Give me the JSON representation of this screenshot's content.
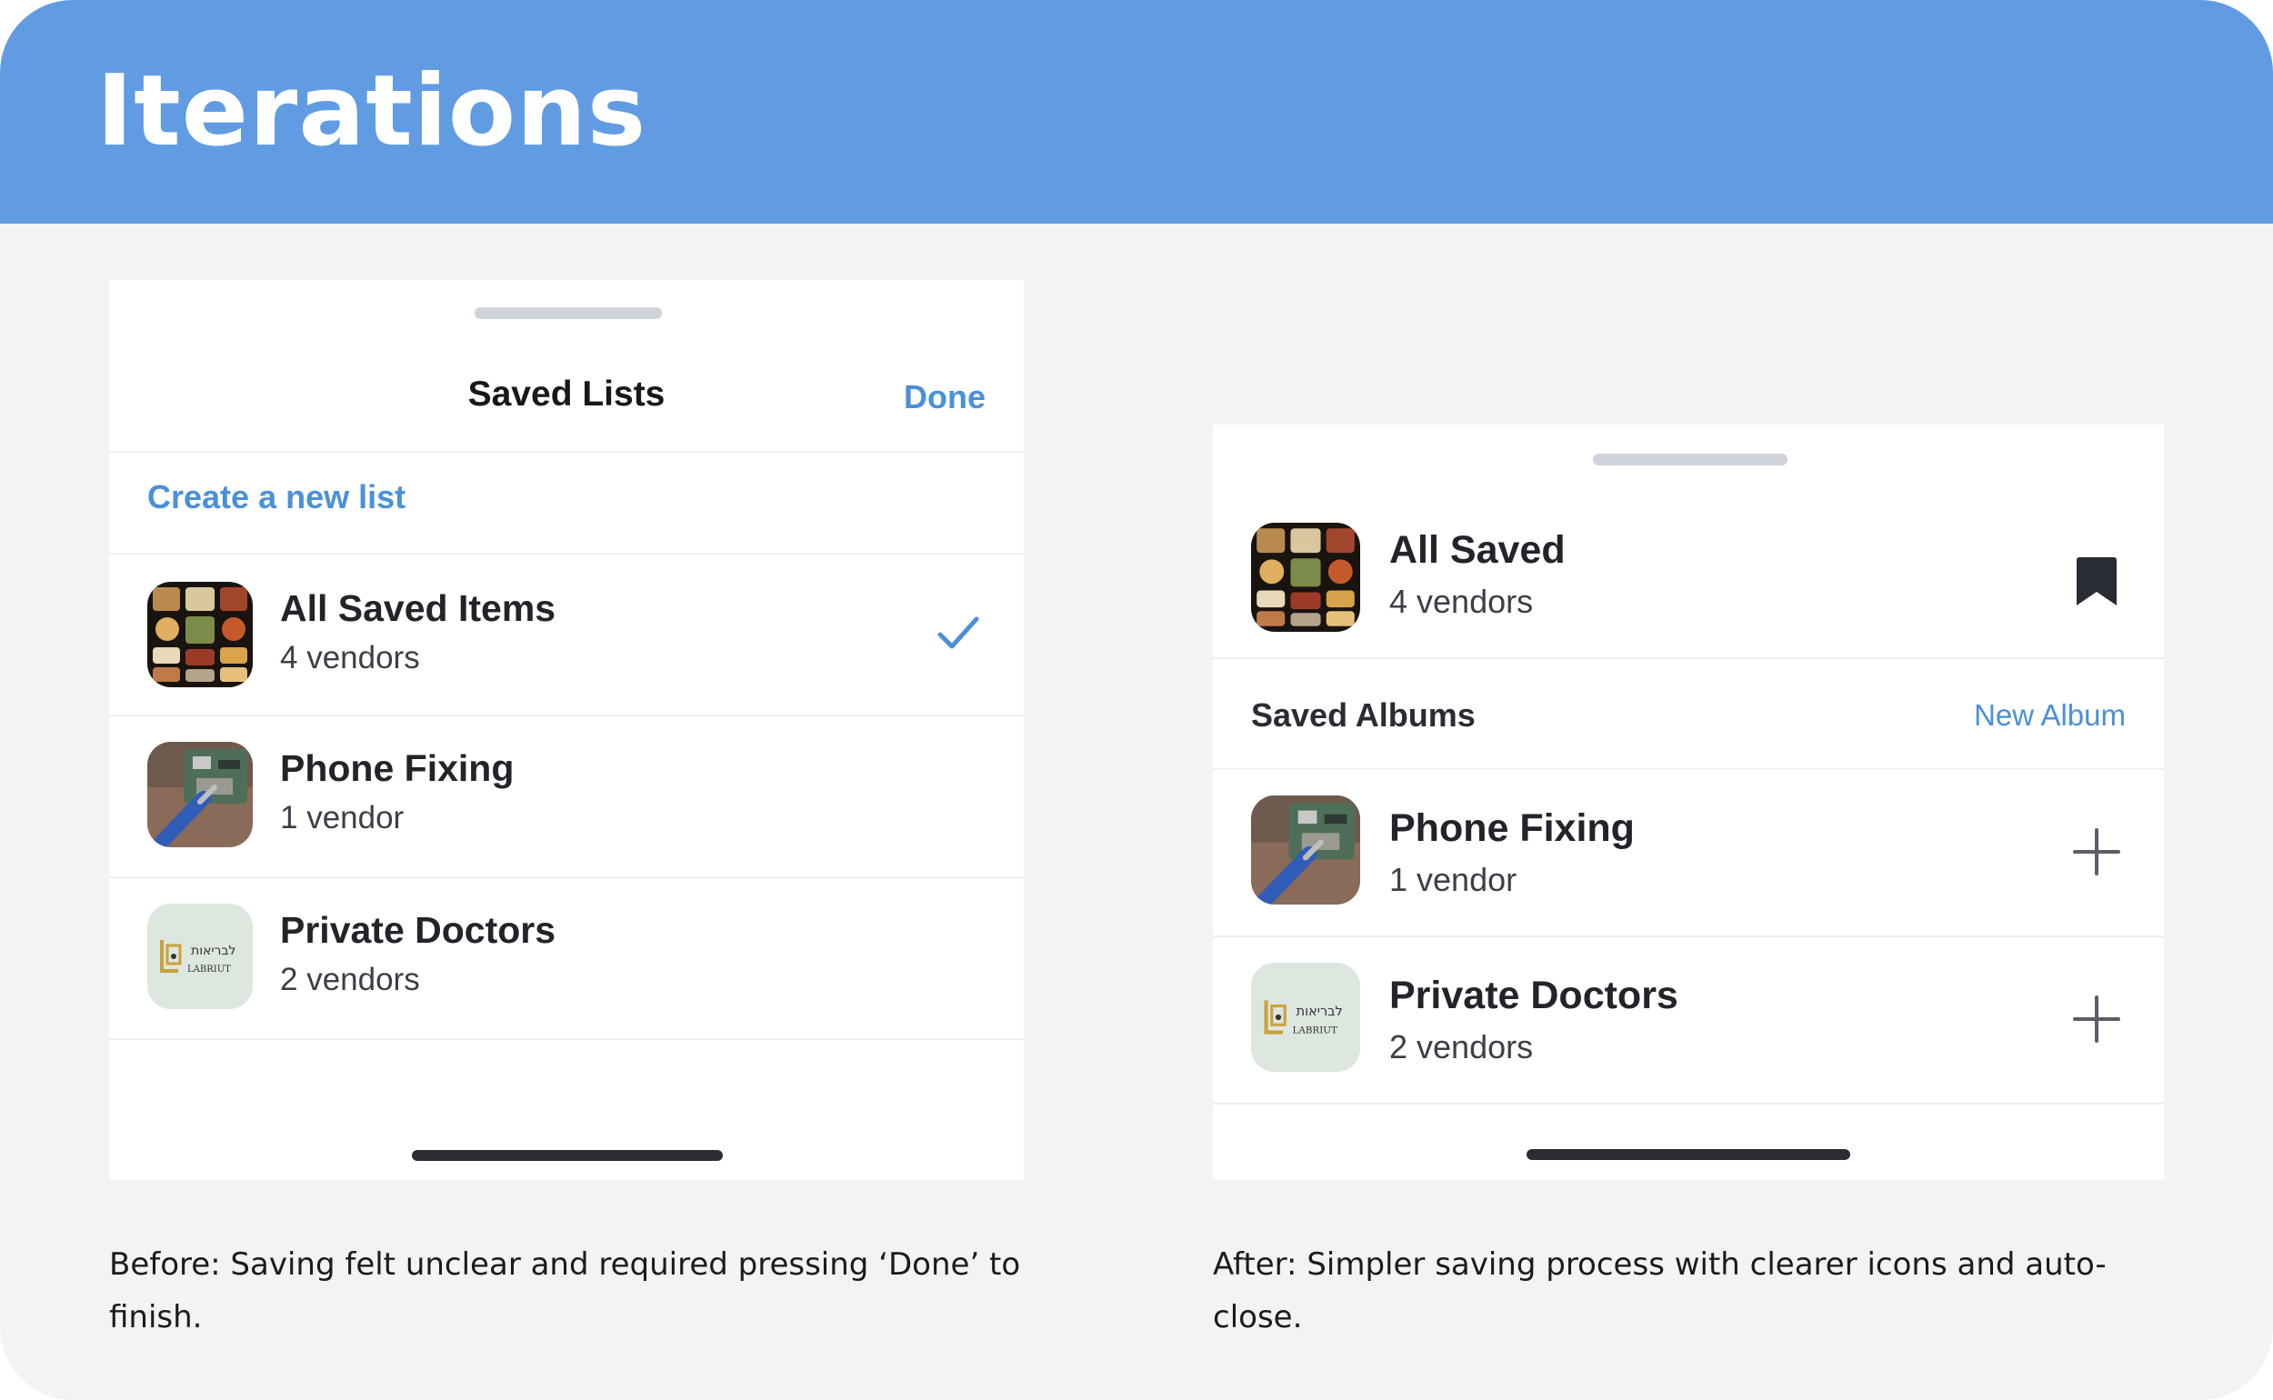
{
  "header": {
    "title": "Iterations"
  },
  "before": {
    "sheet_title": "Saved Lists",
    "done_label": "Done",
    "create_label": "Create a new list",
    "items": [
      {
        "title": "All Saved Items",
        "subtitle": "4 vendors",
        "selected": true,
        "thumb": "food-trays"
      },
      {
        "title": "Phone Fixing",
        "subtitle": "1 vendor",
        "thumb": "circuit-board"
      },
      {
        "title": "Private Doctors",
        "subtitle": "2 vendors",
        "thumb": "labriut-logo"
      }
    ],
    "caption": "Before: Saving felt unclear and required pressing ‘Done’ to finish."
  },
  "after": {
    "all_saved": {
      "title": "All Saved",
      "subtitle": "4 vendors",
      "icon": "bookmark-icon"
    },
    "section_label": "Saved Albums",
    "new_album_label": "New Album",
    "albums": [
      {
        "title": "Phone Fixing",
        "subtitle": "1 vendor",
        "icon": "plus-icon"
      },
      {
        "title": "Private Doctors",
        "subtitle": "2 vendors",
        "icon": "plus-icon"
      }
    ],
    "caption": "After: Simpler saving process with clearer icons and auto-close."
  },
  "logo_text": {
    "hebrew": "לבריאות",
    "latin": "LABRIUT"
  },
  "colors": {
    "header_bg": "#619ce3",
    "accent": "#4a90d9",
    "page_bg": "#f3f3f3"
  }
}
